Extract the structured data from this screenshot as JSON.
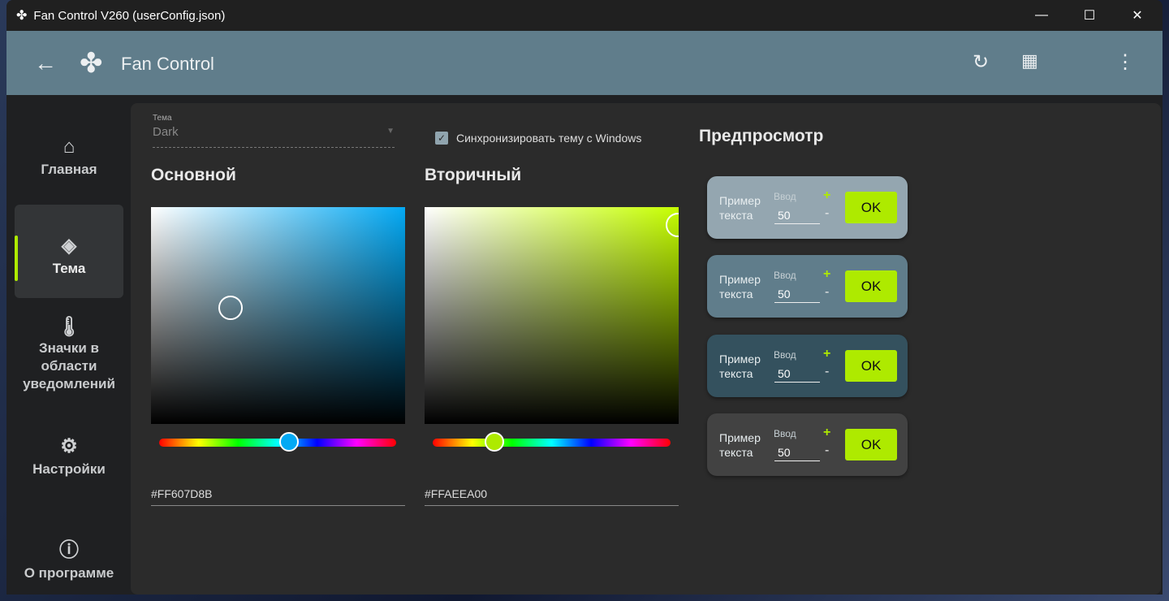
{
  "window": {
    "title": "Fan Control V260 (userConfig.json)",
    "minimize": "—",
    "maximize": "☐",
    "close": "✕"
  },
  "appbar": {
    "title": "Fan Control",
    "back_icon": "arrow-left",
    "refresh_icon": "refresh",
    "dashboard_icon": "dashboard-edit",
    "menu_icon": "more-vertical"
  },
  "sidebar": {
    "items": [
      {
        "label": "Главная",
        "icon": "home"
      },
      {
        "label": "Тема",
        "icon": "paint-bucket",
        "active": true
      },
      {
        "label": "Значки в области уведомлений",
        "icon": "thermometer"
      },
      {
        "label": "Настройки",
        "icon": "gear"
      },
      {
        "label": "О программе",
        "icon": "info"
      }
    ]
  },
  "theme": {
    "label": "Тема",
    "value": "Dark",
    "sync_label": "Синхронизировать тему с Windows",
    "sync_checked": true
  },
  "primary": {
    "heading": "Основной",
    "hex": "#FF607D8B",
    "color": "#607D8B"
  },
  "secondary": {
    "heading": "Вторичный",
    "hex": "#FFAEEA00",
    "color": "#AEEA00"
  },
  "preview": {
    "heading": "Предпросмотр",
    "cards": [
      {
        "text": "Пример текста",
        "input_label": "Ввод",
        "value": "50",
        "plus": "+",
        "minus": "-",
        "ok": "OK",
        "bg": "#90A4AE"
      },
      {
        "text": "Пример текста",
        "input_label": "Ввод",
        "value": "50",
        "plus": "+",
        "minus": "-",
        "ok": "OK",
        "bg": "#607D8B"
      },
      {
        "text": "Пример текста",
        "input_label": "Ввод",
        "value": "50",
        "plus": "+",
        "minus": "-",
        "ok": "OK",
        "bg": "#34515E"
      },
      {
        "text": "Пример текста",
        "input_label": "Ввод",
        "value": "50",
        "plus": "+",
        "minus": "-",
        "ok": "OK",
        "bg": "#424242"
      }
    ]
  }
}
